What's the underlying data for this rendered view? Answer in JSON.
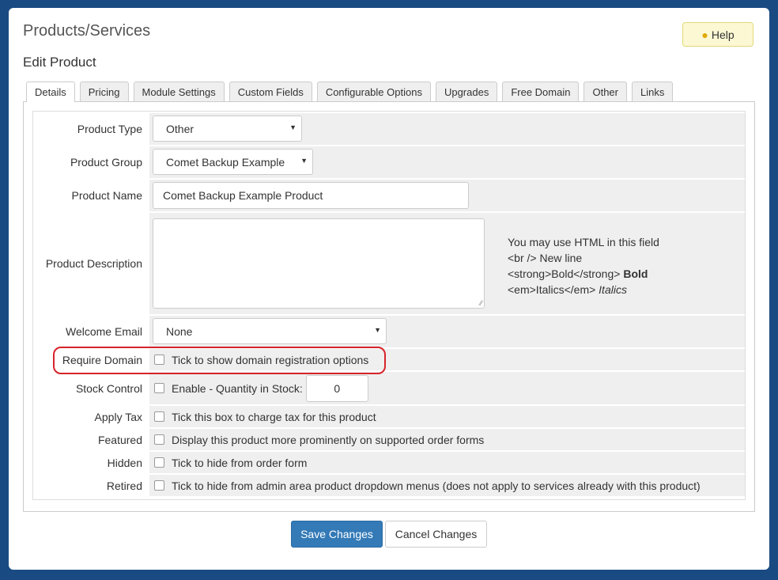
{
  "header": {
    "title": "Products/Services",
    "subtitle": "Edit Product",
    "help_label": "Help",
    "help_icon": "lightbulb-icon"
  },
  "tabs": [
    {
      "label": "Details",
      "active": true
    },
    {
      "label": "Pricing"
    },
    {
      "label": "Module Settings"
    },
    {
      "label": "Custom Fields"
    },
    {
      "label": "Configurable Options"
    },
    {
      "label": "Upgrades"
    },
    {
      "label": "Free Domain"
    },
    {
      "label": "Other"
    },
    {
      "label": "Links"
    }
  ],
  "form": {
    "product_type": {
      "label": "Product Type",
      "value": "Other"
    },
    "product_group": {
      "label": "Product Group",
      "value": "Comet Backup Example"
    },
    "product_name": {
      "label": "Product Name",
      "value": "Comet Backup Example Product"
    },
    "product_description": {
      "label": "Product Description",
      "value": "",
      "hint": {
        "line1": "You may use HTML in this field",
        "line2": "<br /> New line",
        "line3_code": "<strong>Bold</strong>",
        "line3_demo": "Bold",
        "line4_code": "<em>Italics</em>",
        "line4_demo": "Italics"
      }
    },
    "welcome_email": {
      "label": "Welcome Email",
      "value": "None"
    },
    "require_domain": {
      "label": "Require Domain",
      "text": "Tick to show domain registration options",
      "checked": false
    },
    "stock_control": {
      "label": "Stock Control",
      "text": "Enable - Quantity in Stock:",
      "checked": false,
      "quantity": "0"
    },
    "apply_tax": {
      "label": "Apply Tax",
      "text": "Tick this box to charge tax for this product",
      "checked": false
    },
    "featured": {
      "label": "Featured",
      "text": "Display this product more prominently on supported order forms",
      "checked": false
    },
    "hidden": {
      "label": "Hidden",
      "text": "Tick to hide from order form",
      "checked": false
    },
    "retired": {
      "label": "Retired",
      "text": "Tick to hide from admin area product dropdown menus (does not apply to services already with this product)",
      "checked": false
    }
  },
  "actions": {
    "save_label": "Save Changes",
    "cancel_label": "Cancel Changes"
  },
  "colors": {
    "primary": "#337ab7",
    "highlight": "#d6242a",
    "background": "#1a4a82"
  }
}
